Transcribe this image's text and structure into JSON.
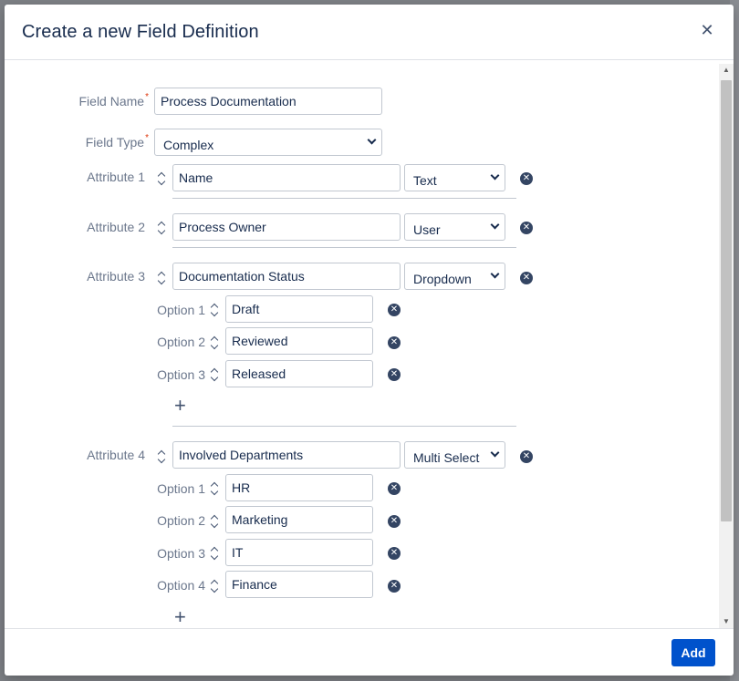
{
  "dialog": {
    "title": "Create a new Field Definition",
    "close_glyph": "✕"
  },
  "form": {
    "field_name_label": "Field Name",
    "field_name_value": "Process Documentation",
    "field_type_label": "Field Type",
    "field_type_value": "Complex",
    "required_marker": "*"
  },
  "attributes": [
    {
      "label": "Attribute 1",
      "name": "Name",
      "type": "Text",
      "options": []
    },
    {
      "label": "Attribute 2",
      "name": "Process Owner",
      "type": "User",
      "options": []
    },
    {
      "label": "Attribute 3",
      "name": "Documentation Status",
      "type": "Dropdown",
      "options": [
        {
          "label": "Option 1",
          "value": "Draft"
        },
        {
          "label": "Option 2",
          "value": "Reviewed"
        },
        {
          "label": "Option 3",
          "value": "Released"
        }
      ]
    },
    {
      "label": "Attribute 4",
      "name": "Involved Departments",
      "type": "Multi Select",
      "options": [
        {
          "label": "Option 1",
          "value": "HR"
        },
        {
          "label": "Option 2",
          "value": "Marketing"
        },
        {
          "label": "Option 3",
          "value": "IT"
        },
        {
          "label": "Option 4",
          "value": "Finance"
        }
      ]
    }
  ],
  "glyphs": {
    "remove": "✕",
    "add_option": "+",
    "scroll_up": "▲",
    "scroll_down": "▼"
  },
  "icons": {
    "close": "close-icon",
    "remove": "remove-circle-icon",
    "sort": "sort-handle-icon",
    "add": "plus-icon",
    "dropdown": "chevron-down-icon"
  },
  "footer": {
    "add_label": "Add"
  },
  "colors": {
    "primary": "#0052cc",
    "required": "#de350b",
    "label": "#6b778c",
    "text": "#172b4d"
  }
}
